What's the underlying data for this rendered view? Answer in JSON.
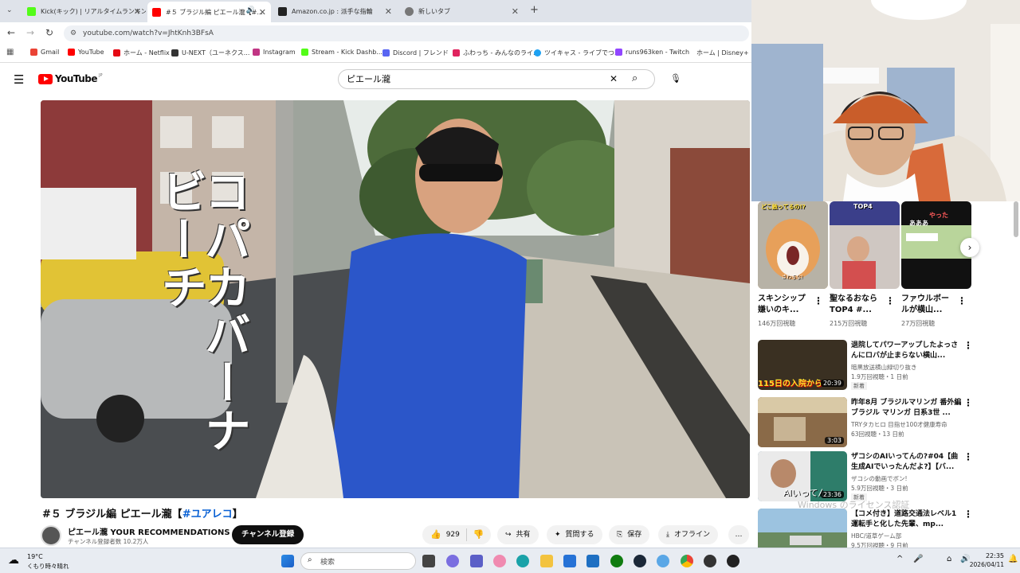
{
  "browser": {
    "tabs": [
      {
        "title": "Kick(キック) | リアルタイムランキング",
        "active": false,
        "favicon_color": "#53fc18"
      },
      {
        "title": "#５ ブラジル編 ピエール瀧【#...",
        "active": true,
        "favicon_color": "#ff0000"
      },
      {
        "title": "Amazon.co.jp : 派手な指輪",
        "active": false,
        "favicon_color": "#222222"
      },
      {
        "title": "新しいタブ",
        "active": false,
        "favicon_color": "#777777"
      }
    ],
    "url": "youtube.com/watch?v=JhtKnh3BFsA",
    "bookmarks": [
      {
        "label": "Gmail",
        "color": "#ea4335"
      },
      {
        "label": "YouTube",
        "color": "#ff0000"
      },
      {
        "label": "ホーム - Netflix",
        "color": "#e50914"
      },
      {
        "label": "U-NEXT（ユーネクス...",
        "color": "#333333"
      },
      {
        "label": "Instagram",
        "color": "#c13584"
      },
      {
        "label": "Stream - Kick Dashb...",
        "color": "#53fc18"
      },
      {
        "label": "Discord | フレンド",
        "color": "#5865f2"
      },
      {
        "label": "ふわっち - みんなのライ...",
        "color": "#e0245e"
      },
      {
        "label": "ツイキャス - ライブでつ...",
        "color": "#1da1f2"
      },
      {
        "label": "runs963ken - Twitch",
        "color": "#9146ff"
      },
      {
        "label": "ホーム | Disney+(デ...",
        "color": "#113ccf"
      }
    ]
  },
  "youtube": {
    "logo": "YouTube",
    "logo_region": "JP",
    "search_value": "ピエール瀧",
    "video": {
      "overlay_text": [
        "コパカバーナ",
        "ビーチ"
      ],
      "title_prefix": "#５ ブラジル編 ピエール瀧【",
      "title_hashtag": "#ユアレコ",
      "title_suffix": "】",
      "channel_name": "ピエール瀧 YOUR RECOMMENDATIONS",
      "subscribers": "チャンネル登録者数 10.2万人",
      "subscribe_label": "チャンネル登録",
      "like_count": "929",
      "share_label": "共有",
      "ask_label": "質問する",
      "save_label": "保存",
      "offline_label": "オフライン",
      "more_label": "…"
    },
    "shorts": [
      {
        "title": "スキンシップ嫌いのキ...",
        "views": "146万回視聴",
        "overlay": "どこ触ってるの!?",
        "caption": "さわるな!",
        "color": "#c98a4a"
      },
      {
        "title": "聖なるおならTOP4 #...",
        "views": "215万回視聴",
        "overlay": "TOP4",
        "caption": "",
        "color": "#7a6a64"
      },
      {
        "title": "ファウルボールが横山...",
        "views": "27万回視聴",
        "overlay": "やった",
        "caption": "あああ",
        "color": "#2a5b2a"
      }
    ],
    "recommendations": [
      {
        "title": "退院してパワーアップしたよっさんにロバが止まらない横山...",
        "channel": "暗黒放送横山緑切り抜き",
        "meta": "1.9万回視聴・1 日前",
        "badge": "新着",
        "duration": "20:39",
        "thumb_text": "115日の入院から",
        "color": "#3a3022"
      },
      {
        "title": "昨年8月 ブラジルマリンガ 番外編 ブラジル マリンガ 日系3世 ...",
        "channel": "TRYタカヒロ 目指せ100才健康寿命",
        "meta": "63回視聴・13 日前",
        "badge": "",
        "duration": "3:03",
        "thumb_text": "",
        "color": "#7a5a3a"
      },
      {
        "title": "ザコシのAIいってんの?#04【曲生成AIでいったんだよ?】【バ...",
        "channel": "ザコシの動画でボン!",
        "meta": "5.9万回視聴・3 日前",
        "badge": "新着",
        "duration": "23:36",
        "thumb_text": "AIいってん",
        "color": "#4a7aa0"
      },
      {
        "title": "【コメ付き】道路交通法レベル1運転手と化した先輩、mp...",
        "channel": "HBC/道草ゲーム部",
        "meta": "9.5万回視聴・9 日前",
        "badge": "",
        "duration": "",
        "thumb_text": "",
        "color": "#6e8a6a"
      }
    ],
    "windows_watermark": "Windows のライセンス認証"
  },
  "taskbar": {
    "weather_temp": "19°C",
    "weather_desc": "くもり時々晴れ",
    "search_placeholder": "検索",
    "clock_time": "22:35",
    "clock_date": "2026/04/11"
  }
}
